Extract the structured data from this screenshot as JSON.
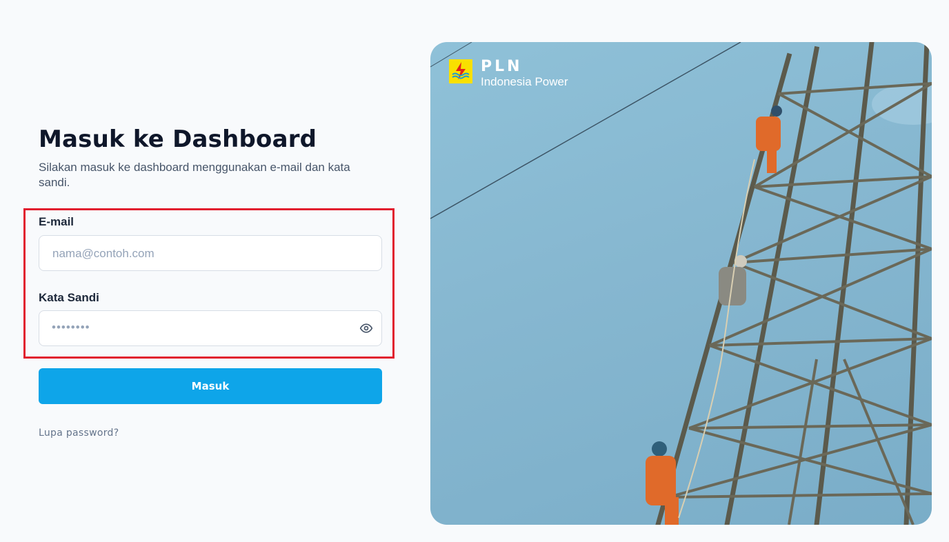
{
  "login": {
    "title": "Masuk ke Dashboard",
    "subtitle": "Silakan masuk ke dashboard menggunakan e-mail dan kata sandi.",
    "email_label": "E-mail",
    "email_placeholder": "nama@contoh.com",
    "password_label": "Kata Sandi",
    "password_masked": "••••••••",
    "submit_label": "Masuk",
    "forgot_label": "Lupa password?"
  },
  "brand": {
    "name": "PLN",
    "subtitle": "Indonesia Power"
  },
  "icons": {
    "password_toggle": "eye-icon",
    "logo": "pln-logo-icon"
  },
  "colors": {
    "primary_button": "#0ea5e9",
    "highlight_border": "#e11d2e",
    "title_text": "#0f172a",
    "page_background": "#f8fafc"
  }
}
